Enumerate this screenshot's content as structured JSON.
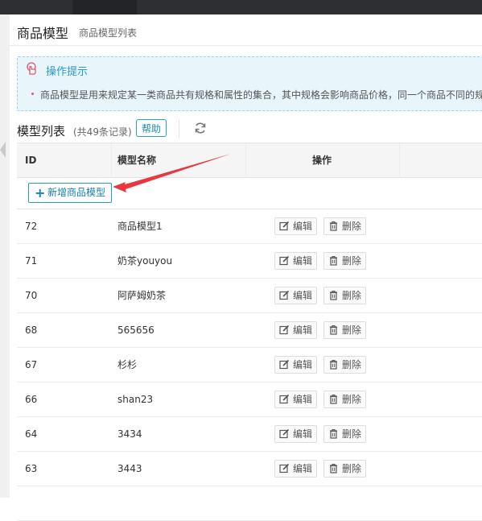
{
  "header": {
    "title": "商品模型",
    "subtitle": "商品模型列表"
  },
  "tips": {
    "title": "操作提示",
    "text": "商品模型是用来规定某一类商品共有规格和属性的集合，其中规格会影响商品价格，同一个商品不同的规"
  },
  "list": {
    "title": "模型列表",
    "count": "(共49条记录)",
    "help_label": "帮助"
  },
  "table": {
    "columns": [
      "ID",
      "模型名称",
      "操作"
    ],
    "add_label": "新增商品模型",
    "edit_label": "编辑",
    "delete_label": "删除",
    "rows": [
      {
        "id": "72",
        "name": "商品模型1"
      },
      {
        "id": "71",
        "name": "奶茶youyou"
      },
      {
        "id": "70",
        "name": "阿萨姆奶茶"
      },
      {
        "id": "68",
        "name": "565656"
      },
      {
        "id": "67",
        "name": "杉杉"
      },
      {
        "id": "66",
        "name": "shan23"
      },
      {
        "id": "64",
        "name": "3434"
      },
      {
        "id": "63",
        "name": "3443"
      },
      {
        "id": "",
        "name": ""
      }
    ]
  },
  "icons": {
    "tips": "hand-pointer-icon",
    "refresh": "refresh-icon",
    "add": "plus-icon",
    "edit": "edit-icon",
    "delete": "trash-icon"
  },
  "colors": {
    "accent": "#1a8fb3",
    "tips_bg": "#e8f5fb",
    "annotation_arrow": "#e8383d"
  }
}
